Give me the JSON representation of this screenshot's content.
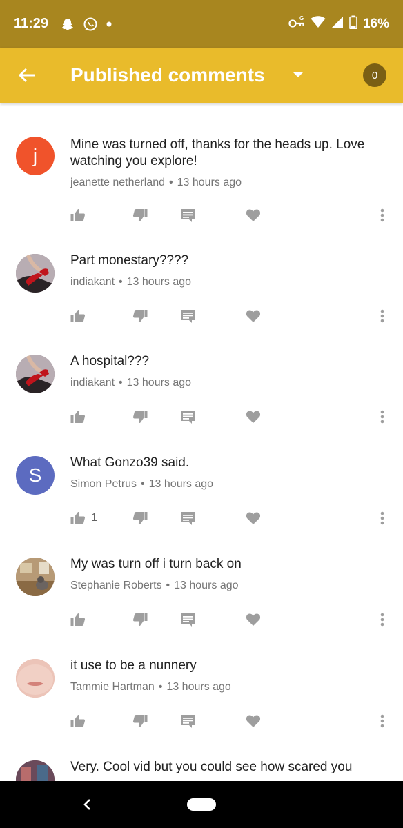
{
  "status_bar": {
    "time": "11:29",
    "battery_percent": "16%"
  },
  "app_bar": {
    "title": "Published comments",
    "count": "0"
  },
  "comments": [
    {
      "avatar_letter": "j",
      "avatar_color": "#f0532b",
      "text": "Mine was turned off, thanks for the heads up. Love watching you explore!",
      "author": "jeanette netherland",
      "separator": "•",
      "time": "13 hours ago",
      "likes": ""
    },
    {
      "avatar_letter": "",
      "avatar_color": "#8a7f86",
      "text": "Part monestary????",
      "author": "indiakant",
      "separator": "•",
      "time": "13 hours ago",
      "likes": ""
    },
    {
      "avatar_letter": "",
      "avatar_color": "#8a7f86",
      "text": "A hospital???",
      "author": "indiakant",
      "separator": "•",
      "time": "13 hours ago",
      "likes": ""
    },
    {
      "avatar_letter": "S",
      "avatar_color": "#5c6bc0",
      "text": "What Gonzo39 said.",
      "author": "Simon Petrus",
      "separator": "•",
      "time": "13 hours ago",
      "likes": "1"
    },
    {
      "avatar_letter": "",
      "avatar_color": "#a08060",
      "text": "My was turn off i turn back on",
      "author": "Stephanie Roberts",
      "separator": "•",
      "time": "13 hours ago",
      "likes": ""
    },
    {
      "avatar_letter": "",
      "avatar_color": "#e8b4a8",
      "text": "it use to be a nunnery",
      "author": "Tammie Hartman",
      "separator": "•",
      "time": "13 hours ago",
      "likes": ""
    },
    {
      "avatar_letter": "",
      "avatar_color": "#6a4a5a",
      "text": "Very. Cool vid but you could see how scared you",
      "author": "",
      "separator": "",
      "time": "",
      "likes": ""
    }
  ]
}
